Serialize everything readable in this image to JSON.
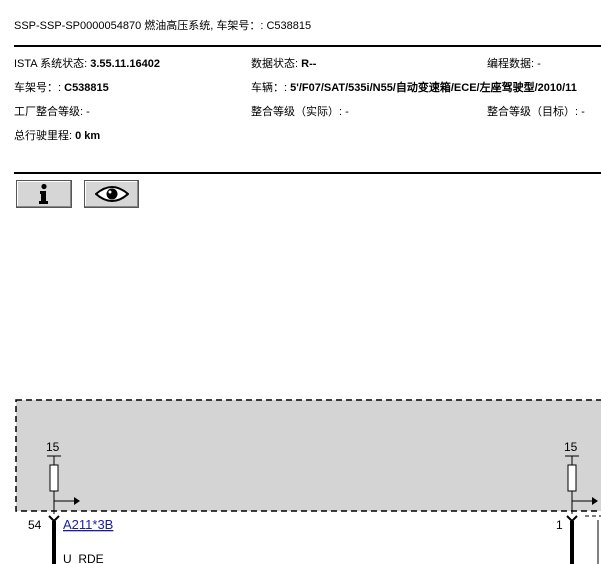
{
  "header": {
    "title": "SSP-SSP-SP0000054870 燃油高压系统, 车架号：: C538815"
  },
  "info": {
    "ista_label": "ISTA 系统状态: ",
    "ista_value": "3.55.11.16402",
    "data_state_label": "数据状态: ",
    "data_state_value": "R--",
    "programming_label": "编程数据: ",
    "programming_value": "-",
    "vin_label": "车架号：: ",
    "vin_value": "C538815",
    "vehicle_label": "车辆：: ",
    "vehicle_value": "5'/F07/SAT/535i/N55/自动变速箱/ECE/左座驾驶型/2010/11",
    "factory_label": "工厂整合等级: ",
    "factory_value": "-",
    "integ_actual_label": "整合等级（实际）: ",
    "integ_actual_value": "-",
    "integ_target_label": "整合等级（目标）: ",
    "integ_target_value": "-",
    "mileage_label": "总行驶里程: ",
    "mileage_value": "0 km"
  },
  "toolbar": {
    "info_icon": "info-icon",
    "view_icon": "eye-icon"
  },
  "diagram": {
    "terminal_left": "15",
    "terminal_right": "15",
    "pin_left": "54",
    "pin_right": "1",
    "connector_link": "A211*3B",
    "wire_label": "U_RDE"
  }
}
